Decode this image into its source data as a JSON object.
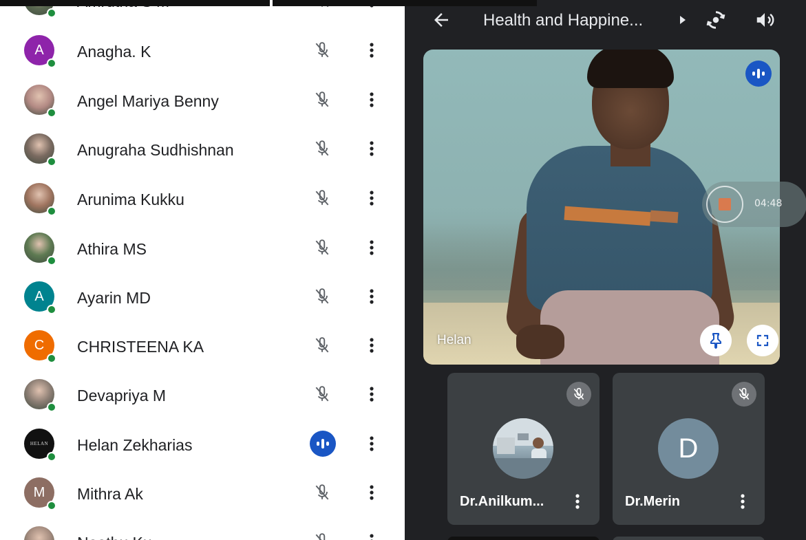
{
  "participants": [
    {
      "name": "Amrutha S M",
      "avatar_type": "photo",
      "avatar_letter": "",
      "avatar_color": "#5d6b53",
      "mic": "muted"
    },
    {
      "name": "Anagha. K",
      "avatar_type": "letter",
      "avatar_letter": "A",
      "avatar_color": "#8e24aa",
      "mic": "muted"
    },
    {
      "name": "Angel Mariya Benny",
      "avatar_type": "photo",
      "avatar_letter": "",
      "avatar_color": "#b38a84",
      "mic": "muted"
    },
    {
      "name": "Anugraha Sudhishnan",
      "avatar_type": "photo",
      "avatar_letter": "",
      "avatar_color": "#7a6a60",
      "mic": "muted"
    },
    {
      "name": "Arunima Kukku",
      "avatar_type": "photo",
      "avatar_letter": "",
      "avatar_color": "#a07560",
      "mic": "muted"
    },
    {
      "name": "Athira MS",
      "avatar_type": "photo",
      "avatar_letter": "",
      "avatar_color": "#5e7a52",
      "mic": "muted"
    },
    {
      "name": "Ayarin MD",
      "avatar_type": "letter",
      "avatar_letter": "A",
      "avatar_color": "#00838f",
      "mic": "muted"
    },
    {
      "name": "CHRISTEENA KA",
      "avatar_type": "letter",
      "avatar_letter": "C",
      "avatar_color": "#ef6c00",
      "mic": "muted"
    },
    {
      "name": "Devapriya M",
      "avatar_type": "photo",
      "avatar_letter": "",
      "avatar_color": "#8c7e74",
      "mic": "muted"
    },
    {
      "name": "Helan Zekharias",
      "avatar_type": "brand",
      "avatar_letter": "HELAN",
      "avatar_color": "#111111",
      "mic": "speaking"
    },
    {
      "name": "Mithra Ak",
      "avatar_type": "letter",
      "avatar_letter": "M",
      "avatar_color": "#8d6e63",
      "mic": "muted"
    },
    {
      "name": "Neethu Ku",
      "avatar_type": "photo",
      "avatar_letter": "",
      "avatar_color": "#a38b7e",
      "mic": "muted"
    }
  ],
  "meeting": {
    "title": "Health and Happine...",
    "main_tile_name": "Helan",
    "recording_time": "04:48"
  },
  "tiles": [
    {
      "name": "Dr.Anilkum...",
      "avatar_type": "photo",
      "letter": ""
    },
    {
      "name": "Dr.Merin",
      "avatar_type": "letter",
      "letter": "D"
    }
  ],
  "icons": {
    "back": "arrow-back-icon",
    "switch_camera": "switch-camera-icon",
    "volume": "volume-icon",
    "mic_off": "mic-off-icon",
    "speaking": "audio-level-icon",
    "pin": "pin-icon",
    "fullscreen": "fullscreen-icon",
    "more": "more-vert-icon"
  },
  "colors": {
    "speaking_blue": "#1a56c4",
    "status_green": "#1e8e3e",
    "panel_bg": "#202124",
    "tile_bg": "#3c4043"
  }
}
